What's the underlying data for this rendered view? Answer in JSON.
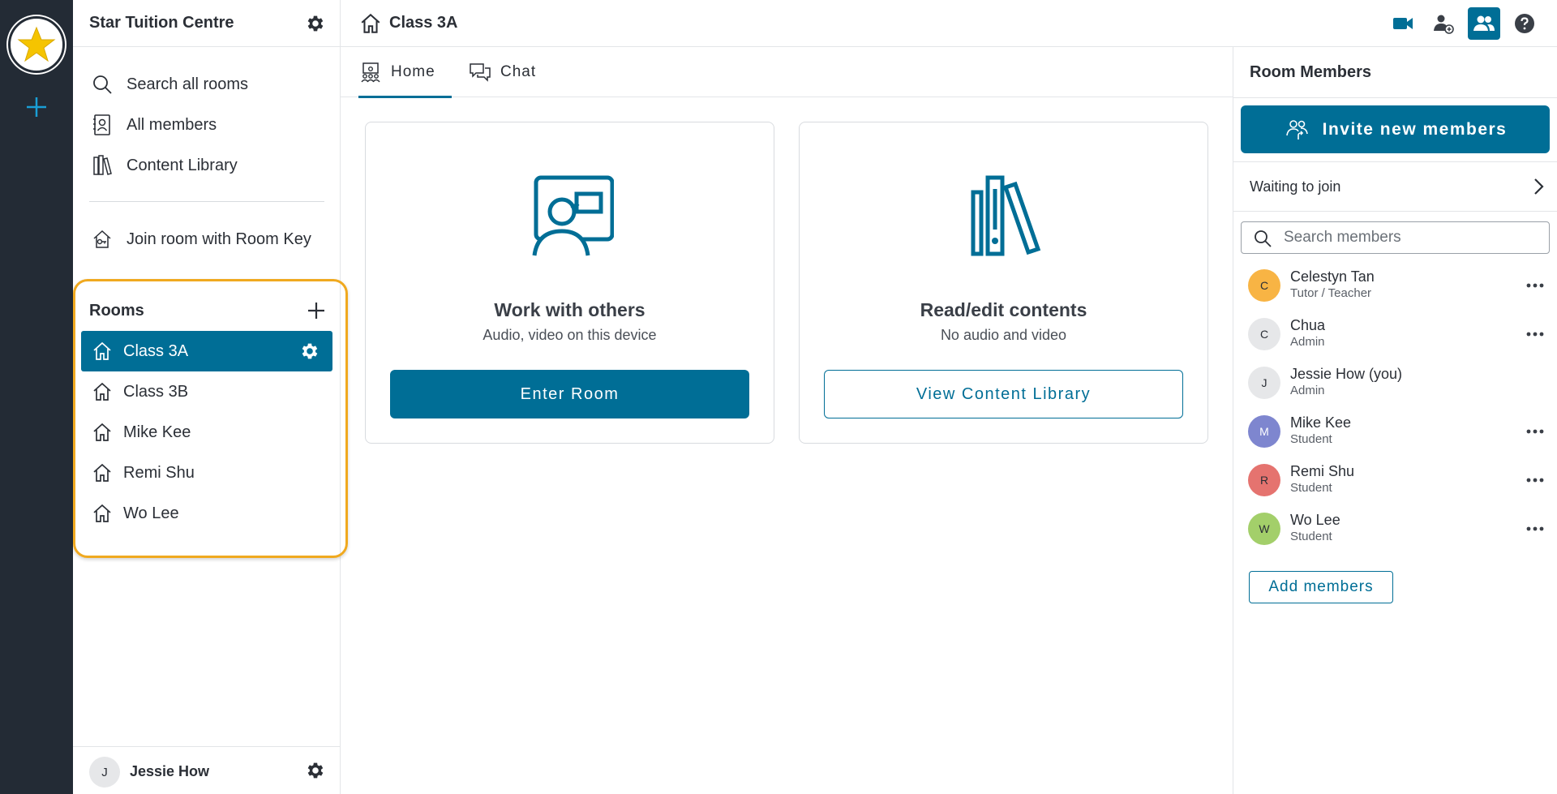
{
  "rail": {
    "add_icon": "plus-icon",
    "logo_icon": "star-icon"
  },
  "sidebar": {
    "org_name": "Star Tuition Centre",
    "nav": [
      {
        "label": "Search all rooms",
        "icon": "search-icon"
      },
      {
        "label": "All members",
        "icon": "contacts-icon"
      },
      {
        "label": "Content Library",
        "icon": "library-icon"
      },
      {
        "label": "Join room with Room Key",
        "icon": "key-house-icon"
      }
    ],
    "rooms_title": "Rooms",
    "rooms": [
      {
        "label": "Class 3A",
        "active": true
      },
      {
        "label": "Class 3B"
      },
      {
        "label": "Mike Kee"
      },
      {
        "label": "Remi Shu"
      },
      {
        "label": "Wo Lee"
      }
    ],
    "user": {
      "initial": "J",
      "name": "Jessie How"
    }
  },
  "topbar": {
    "room_title": "Class 3A",
    "actions": [
      "video-camera-icon",
      "add-user-icon",
      "members-icon",
      "help-icon"
    ]
  },
  "tabs": [
    {
      "label": "Home",
      "active": true
    },
    {
      "label": "Chat"
    }
  ],
  "cards": [
    {
      "title": "Work with others",
      "subtitle": "Audio, video on this device",
      "button": "Enter Room"
    },
    {
      "title": "Read/edit contents",
      "subtitle": "No audio and video",
      "button": "View Content Library"
    }
  ],
  "right_panel": {
    "title": "Room Members",
    "invite_label": "Invite new members",
    "waiting_label": "Waiting to join",
    "search_placeholder": "Search members",
    "members": [
      {
        "initial": "C",
        "name": "Celestyn Tan",
        "role": "Tutor / Teacher",
        "color": "#f8b444",
        "more": true
      },
      {
        "initial": "C",
        "name": "Chua",
        "role": "Admin",
        "color": "#e6e7e9",
        "more": true
      },
      {
        "initial": "J",
        "name": "Jessie How (you)",
        "role": "Admin",
        "color": "#e6e7e9",
        "more": false
      },
      {
        "initial": "M",
        "name": "Mike Kee",
        "role": "Student",
        "color": "#7e86cf",
        "more": true
      },
      {
        "initial": "R",
        "name": "Remi Shu",
        "role": "Student",
        "color": "#e5736f",
        "more": true
      },
      {
        "initial": "W",
        "name": "Wo Lee",
        "role": "Student",
        "color": "#a3cf6a",
        "more": true
      }
    ],
    "add_members_label": "Add members"
  },
  "colors": {
    "accent": "#006e96",
    "highlight": "#f0a91f",
    "rail_bg": "#232b35"
  }
}
